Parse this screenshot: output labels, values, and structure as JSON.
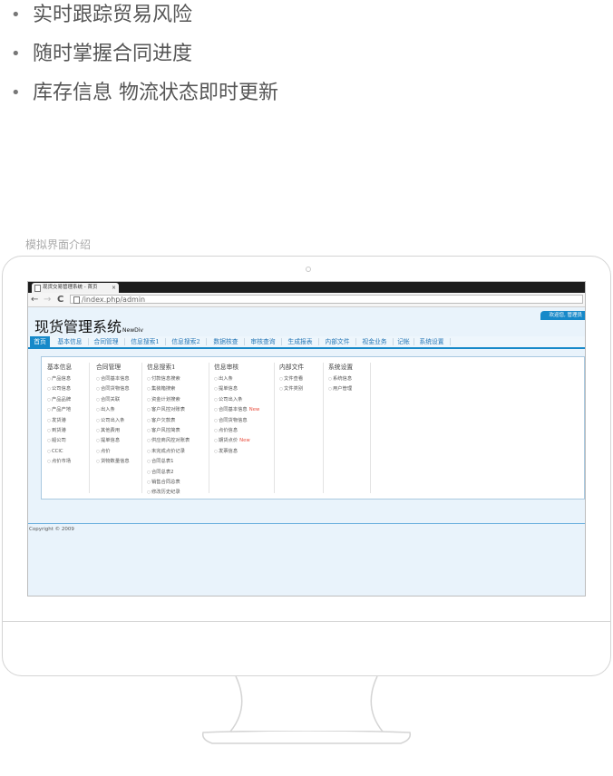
{
  "features": [
    "实时跟踪贸易风险",
    "随时掌握合同进度",
    "库存信息 物流状态即时更新"
  ],
  "section_label": "模拟界面介绍",
  "browser": {
    "tab_title": "现货交易管理系统 - 首页",
    "tab_close": "×",
    "back": "←",
    "forward": "→",
    "reload": "C",
    "url": "/index.php/admin"
  },
  "app": {
    "title": "现货管理系统",
    "subtitle": "NewDiv",
    "welcome": "欢迎您, 管理员"
  },
  "nav": [
    {
      "label": "首页"
    },
    {
      "label": "基本信息"
    },
    {
      "label": "合同管理"
    },
    {
      "label": "信息搜索1"
    },
    {
      "label": "信息搜索2"
    },
    {
      "label": "数据核查"
    },
    {
      "label": "审核查询"
    },
    {
      "label": "生成报表"
    },
    {
      "label": "内部文件"
    },
    {
      "label": "视金业务"
    },
    {
      "label": "记帐"
    },
    {
      "label": "系统设置"
    }
  ],
  "bullet": "○",
  "columns": [
    {
      "title": "基本信息",
      "items": [
        "产品信息",
        "公司信息",
        "产品品牌",
        "产品产地",
        "发货港",
        "到货港",
        "船公司",
        "CCIC",
        "点价市场"
      ]
    },
    {
      "title": "合同管理",
      "items": [
        "合同基本信息",
        "合同货物信息",
        "合同关联",
        "出入条",
        "公司出入条",
        "其他费用",
        "提单信息",
        "点价",
        "货物数量信息"
      ]
    },
    {
      "title": "信息搜索1",
      "items": [
        "付款信息搜索",
        "集装箱搜索",
        "资金计划搜索",
        "客户风控对账表",
        "客户欠款表",
        "客户风控简表",
        "供应商风控对账表",
        "未完成点价记录",
        "合同总表1",
        "合同总表2",
        "销售合同总表",
        "修改历史纪录"
      ]
    },
    {
      "title": "信息审核",
      "items": [
        {
          "text": "出入条"
        },
        {
          "text": "提单信息"
        },
        {
          "text": "公司出入条"
        },
        {
          "text": "合同基本信息",
          "new": "New"
        },
        {
          "text": "合同货物信息"
        },
        {
          "text": "点价信息"
        },
        {
          "text": "期货点价",
          "new": "New"
        },
        {
          "text": "发票信息"
        }
      ]
    },
    {
      "title": "内部文件",
      "items": [
        "文件查看",
        "文件类别"
      ]
    },
    {
      "title": "系统设置",
      "items": [
        "系统信息",
        "用户管理"
      ]
    }
  ],
  "copyright": "Copyright © 2009"
}
